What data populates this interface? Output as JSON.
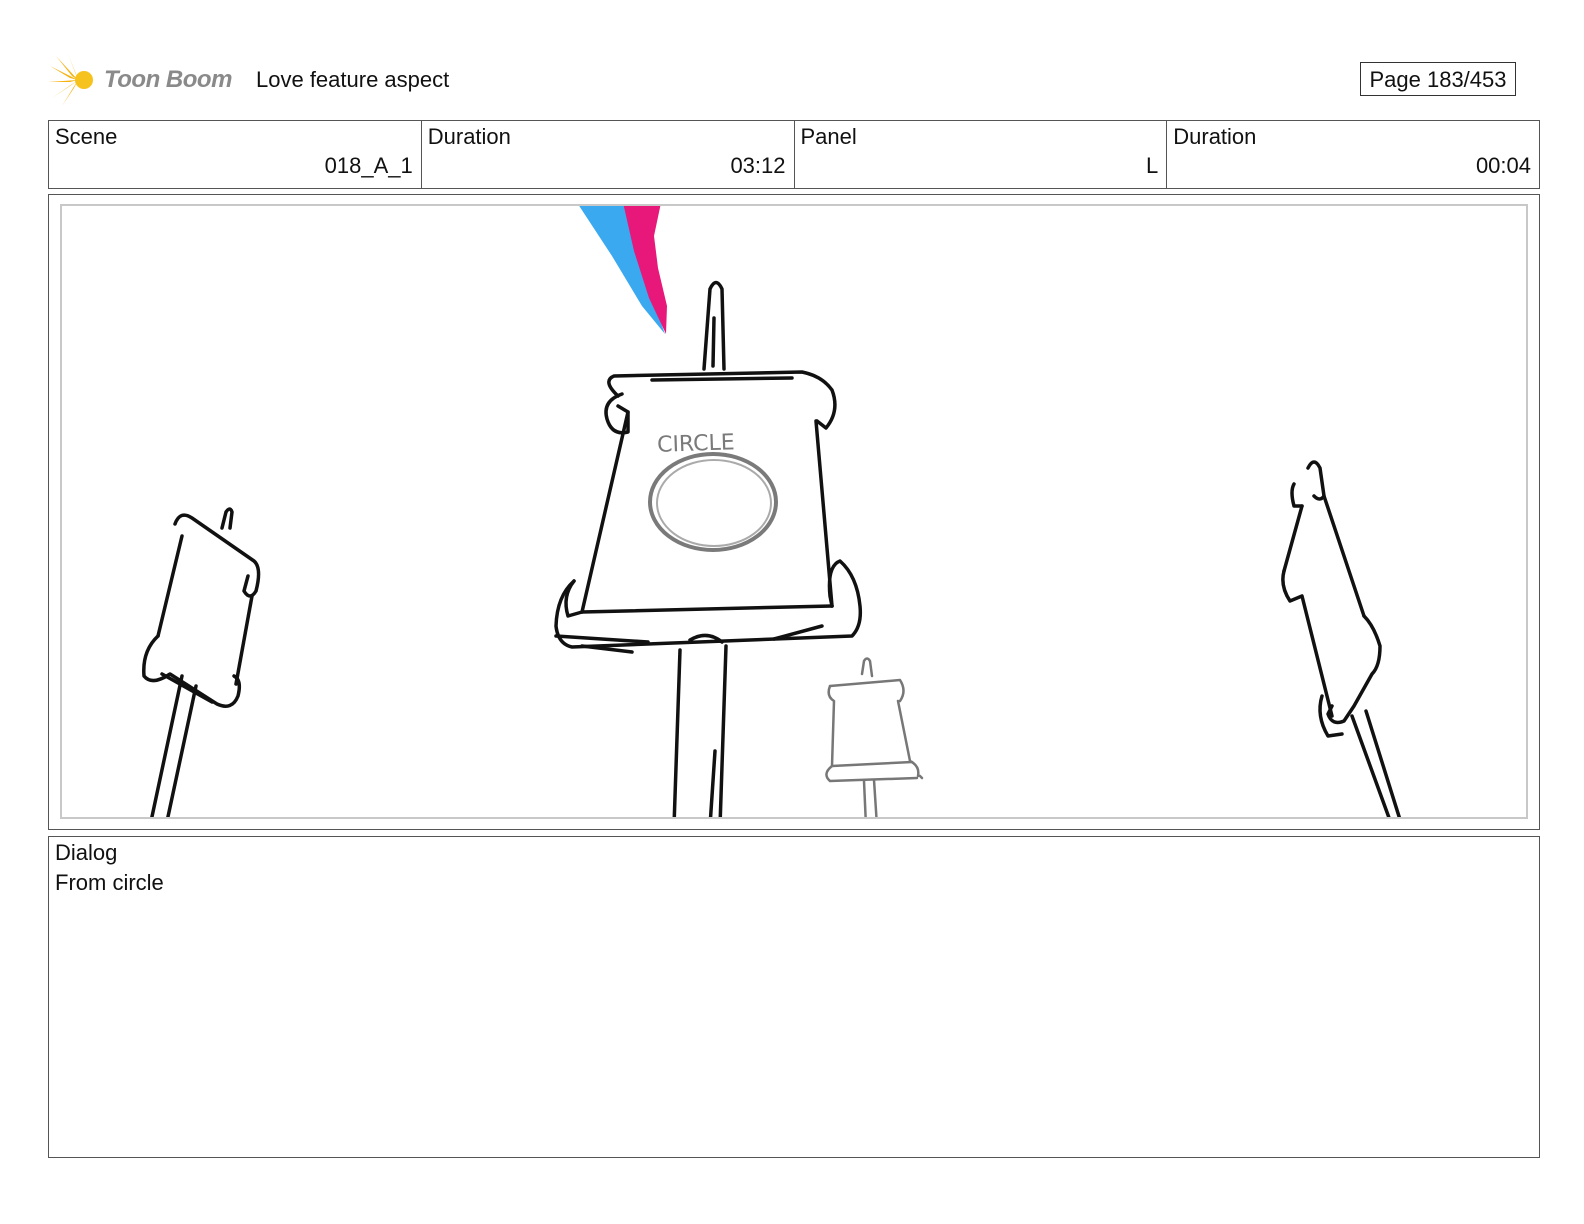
{
  "header": {
    "logo_text": "Toon Boom",
    "title": "Love feature aspect",
    "page_counter": "Page 183/453"
  },
  "info": {
    "scene_label": "Scene",
    "scene_value": "018_A_1",
    "scene_duration_label": "Duration",
    "scene_duration_value": "03:12",
    "panel_label": "Panel",
    "panel_value": "L",
    "panel_duration_label": "Duration",
    "panel_duration_value": "00:04"
  },
  "panel": {
    "sign_text": "CIRCLE",
    "colors": {
      "ribbon_blue": "#3aa9f0",
      "ribbon_pink": "#e8177a",
      "sketch_ink": "#111111",
      "sketch_faint": "#777777"
    }
  },
  "dialog": {
    "label": "Dialog",
    "text": "From circle"
  }
}
